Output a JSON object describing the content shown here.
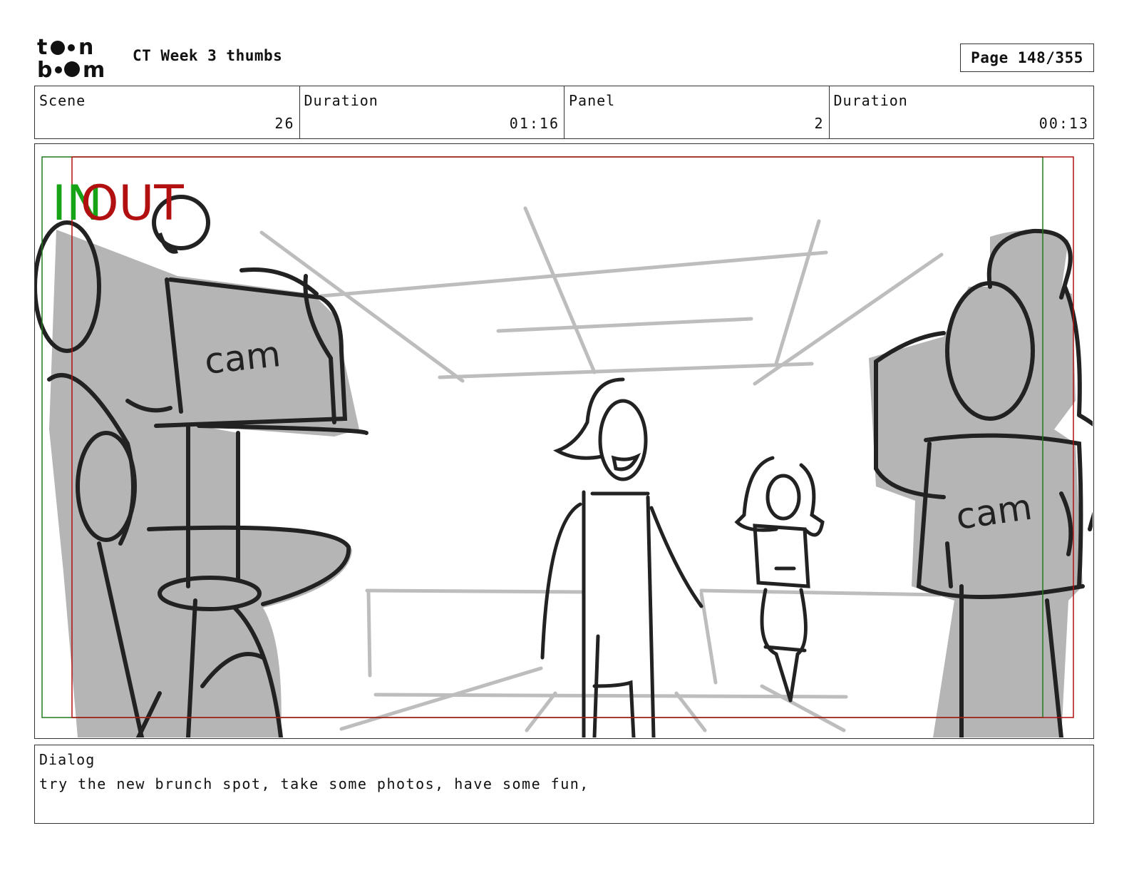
{
  "header": {
    "logo_text_top": "toon",
    "logo_text_bottom": "boom",
    "title": "CT Week 3 thumbs",
    "page": "Page 148/355"
  },
  "info": [
    {
      "label": "Scene",
      "value": "26"
    },
    {
      "label": "Duration",
      "value": "01:16"
    },
    {
      "label": "Panel",
      "value": "2"
    },
    {
      "label": "Duration",
      "value": "00:13"
    }
  ],
  "panel": {
    "in_label": "IN",
    "out_label": "OUT",
    "cam_left": "cam",
    "cam_right": "cam",
    "colors": {
      "in": "#16a316",
      "out": "#b21010",
      "fill": "#b5b5b5",
      "ink": "#222222",
      "guide": "#bdbdbd"
    }
  },
  "dialog": {
    "label": "Dialog",
    "text": "try the new brunch spot, take some photos, have some fun,"
  }
}
